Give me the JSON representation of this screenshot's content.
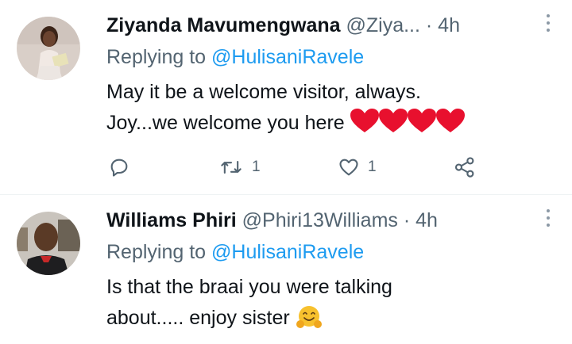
{
  "tweets": [
    {
      "name": "Ziyanda Mavumengwana",
      "handle": "@Ziya...",
      "dot": "·",
      "time": "4h",
      "replying_prefix": "Replying to",
      "replying_to": "@HulisaniRavele",
      "body_line1": "May it be a welcome visitor, always.",
      "body_line2": "Joy...we welcome you here",
      "emoji": "❤️❤️❤️❤️",
      "replies": "",
      "retweets": "1",
      "likes": "1",
      "avatar_icon": "user-avatar-woman"
    },
    {
      "name": "Williams Phiri",
      "handle": "@Phiri13Williams",
      "dot": "·",
      "time": "4h",
      "replying_prefix": "Replying to",
      "replying_to": "@HulisaniRavele",
      "body_line1": "Is that the braai you were talking",
      "body_line2": "about..... enjoy sister",
      "emoji": "🤗",
      "avatar_icon": "user-avatar-man"
    }
  ],
  "colors": {
    "text": "#0f1419",
    "secondary": "#536471",
    "accent": "#1d9bf0",
    "heart": "#e8102e"
  }
}
